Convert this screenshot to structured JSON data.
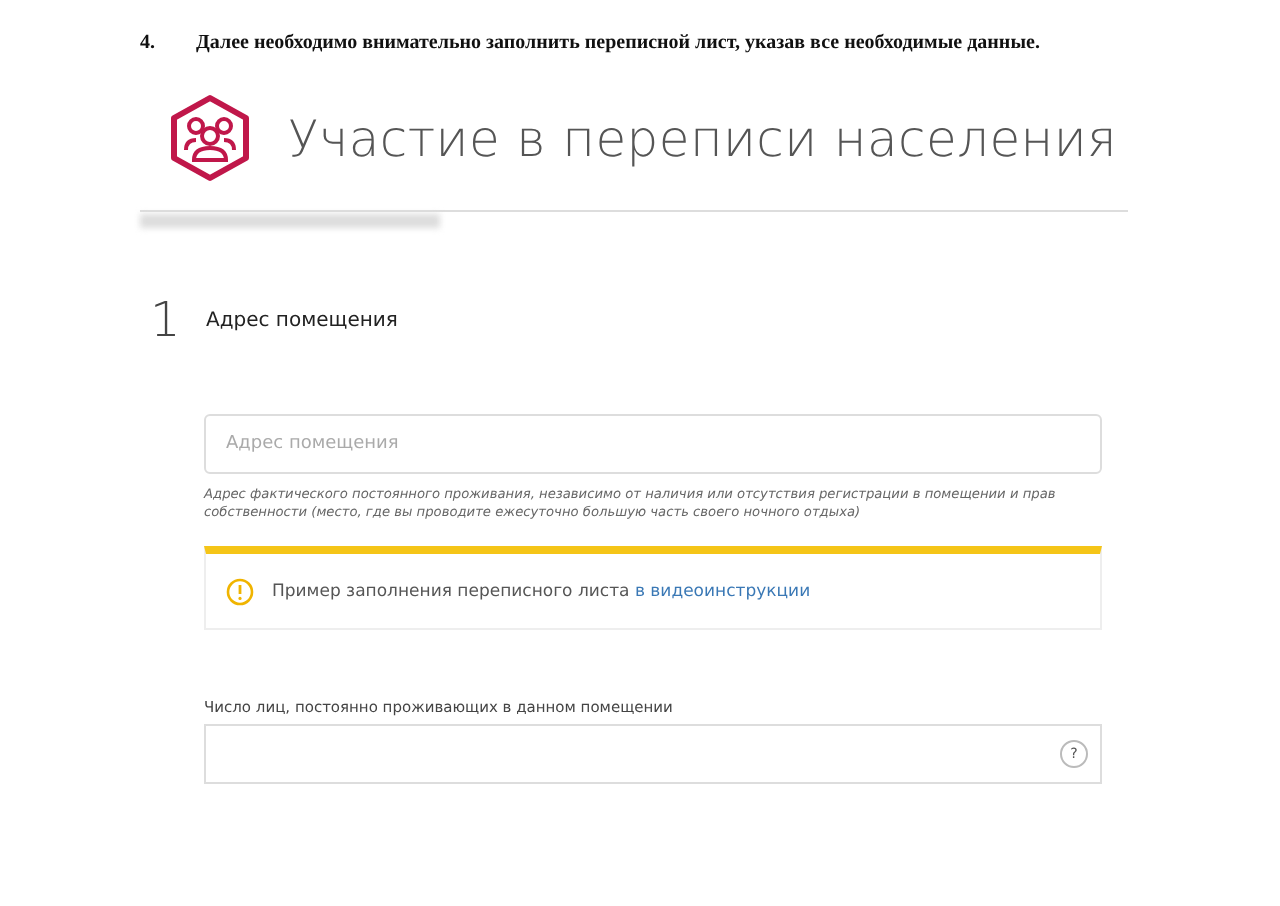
{
  "instruction": {
    "number": "4.",
    "text": "Далее необходимо внимательно заполнить переписной лист, указав все необходимые данные."
  },
  "header": {
    "title": "Участие в переписи населения"
  },
  "step": {
    "number": "1",
    "title": "Адрес помещения"
  },
  "address_field": {
    "placeholder": "Адрес помещения",
    "hint": "Адрес фактического постоянного проживания, независимо от наличия или отсутствия регистрации в помещении и прав собственности (место, где вы проводите ежесуточно большую часть своего ночного отдыха)"
  },
  "notice": {
    "text": "Пример заполнения переписного листа",
    "link": "в видеоинструкции"
  },
  "residents_field": {
    "label": "Число лиц, постоянно проживающих в данном помещении",
    "help": "?"
  }
}
